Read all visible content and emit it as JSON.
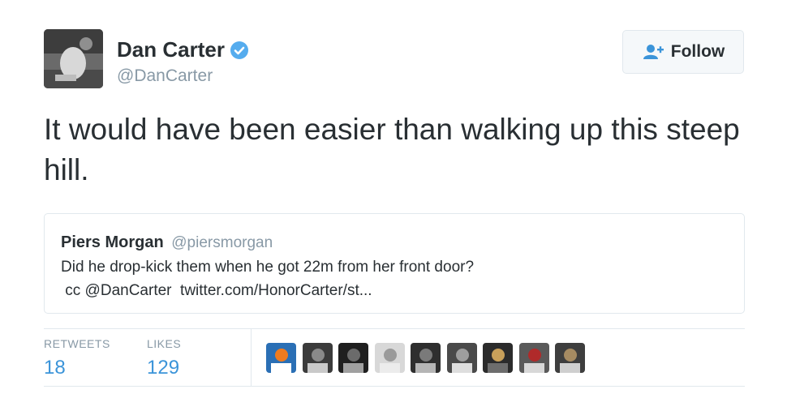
{
  "author": {
    "name": "Dan Carter",
    "handle": "@DanCarter",
    "verified": true
  },
  "follow_button": {
    "label": "Follow",
    "icon": "add-user-icon"
  },
  "tweet": {
    "text": "It would have been easier than walking up this steep hill."
  },
  "quoted_tweet": {
    "name": "Piers Morgan",
    "handle": "@piersmorgan",
    "line1": "Did he drop-kick them when he got 22m from her front door?",
    "line2": " cc @DanCarter  twitter.com/HonorCarter/st..."
  },
  "stats": {
    "retweets_label": "RETWEETS",
    "retweets_count": "18",
    "likes_label": "LIKES",
    "likes_count": "129"
  },
  "colors": {
    "accent": "#3b94d9",
    "verified": "#55acee",
    "muted": "#8899a6",
    "border": "#e1e8ed"
  },
  "liker_avatars": [
    "avatar-1",
    "avatar-2",
    "avatar-3",
    "avatar-4",
    "avatar-5",
    "avatar-6",
    "avatar-7",
    "avatar-8",
    "avatar-9",
    "avatar-10"
  ]
}
